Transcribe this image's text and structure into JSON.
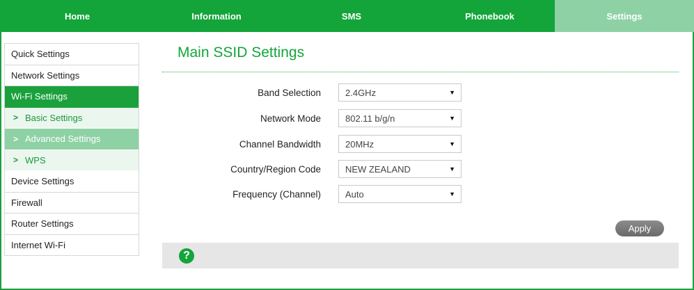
{
  "nav": {
    "tabs": [
      {
        "label": "Home"
      },
      {
        "label": "Information"
      },
      {
        "label": "SMS"
      },
      {
        "label": "Phonebook"
      },
      {
        "label": "Settings",
        "active": true
      }
    ]
  },
  "sidebar": {
    "items": [
      {
        "label": "Quick Settings"
      },
      {
        "label": "Network Settings"
      },
      {
        "label": "Wi-Fi Settings",
        "active": true
      },
      {
        "label": "Basic Settings",
        "sub": true
      },
      {
        "label": "Advanced Settings",
        "sub": true,
        "active": true
      },
      {
        "label": "WPS",
        "sub": true
      },
      {
        "label": "Device Settings"
      },
      {
        "label": "Firewall"
      },
      {
        "label": "Router Settings"
      },
      {
        "label": "Internet Wi-Fi"
      }
    ]
  },
  "main": {
    "title": "Main SSID Settings",
    "fields": [
      {
        "label": "Band Selection",
        "value": "2.4GHz"
      },
      {
        "label": "Network Mode",
        "value": "802.11 b/g/n"
      },
      {
        "label": "Channel Bandwidth",
        "value": "20MHz"
      },
      {
        "label": "Country/Region Code",
        "value": "NEW ZEALAND"
      },
      {
        "label": "Frequency (Channel)",
        "value": "Auto"
      }
    ],
    "apply_label": "Apply",
    "help_icon": "?"
  },
  "colors": {
    "brand_green": "#13a53a",
    "active_light_green": "#8ed1a5",
    "button_grey": "#7a7a7a"
  },
  "icons": {
    "chevron": "chevron-right-icon",
    "dropdown": "dropdown-arrow-icon",
    "help": "help-question-icon"
  }
}
